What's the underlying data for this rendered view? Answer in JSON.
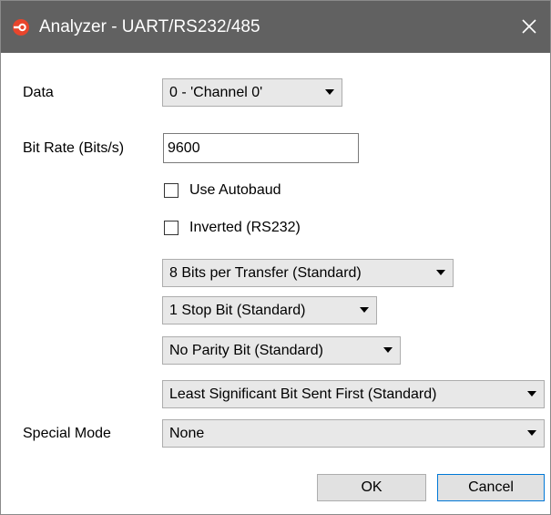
{
  "window": {
    "title": "Analyzer - UART/RS232/485",
    "app_icon": "saleae-logo-icon",
    "close_icon": "close-icon",
    "titlebar_color": "#616161"
  },
  "fields": {
    "data_label": "Data",
    "data_value": "0 - 'Channel 0'",
    "bitrate_label": "Bit Rate (Bits/s)",
    "bitrate_value": "9600",
    "autobaud_label": "Use Autobaud",
    "autobaud_checked": false,
    "inverted_label": "Inverted (RS232)",
    "inverted_checked": false,
    "bits_per_transfer": "8 Bits per Transfer (Standard)",
    "stop_bits": "1 Stop Bit (Standard)",
    "parity": "No Parity Bit (Standard)",
    "bit_order": "Least Significant Bit Sent First (Standard)",
    "special_mode_label": "Special Mode",
    "special_mode_value": "None"
  },
  "buttons": {
    "ok": "OK",
    "cancel": "Cancel"
  }
}
